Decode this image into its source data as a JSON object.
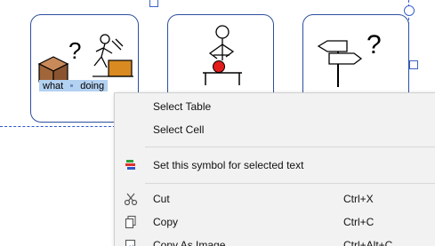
{
  "symbol_cells": [
    {
      "name": "what-doing-cell",
      "words": [
        "what",
        "doing"
      ],
      "icon": "question-box-and-person-working-icon"
    },
    {
      "name": "person-at-table-cell",
      "words": [],
      "icon": "person-at-table-icon"
    },
    {
      "name": "signpost-question-cell",
      "words": [],
      "icon": "signpost-question-icon"
    }
  ],
  "context_menu": {
    "items": [
      {
        "label": "Select Table",
        "shortcut": "",
        "icon": ""
      },
      {
        "label": "Select Cell",
        "shortcut": "",
        "icon": ""
      },
      {
        "label": "Set this symbol for selected text",
        "shortcut": "",
        "icon": "symbol-set-icon"
      },
      {
        "label": "Cut",
        "shortcut": "Ctrl+X",
        "icon": "scissors-icon"
      },
      {
        "label": "Copy",
        "shortcut": "Ctrl+C",
        "icon": "copy-icon"
      },
      {
        "label": "Copy As Image",
        "shortcut": "Ctrl+Alt+C",
        "icon": "copy-image-icon"
      }
    ]
  },
  "colors": {
    "cell_border": "#2b4f9e",
    "selection": "#b3d1f0",
    "guide_line": "#2f58c9",
    "menu_background": "#f2f2f2",
    "box_brown": "#a0663a",
    "tool_orange": "#d98a21",
    "red_dot": "#e21b1b"
  }
}
